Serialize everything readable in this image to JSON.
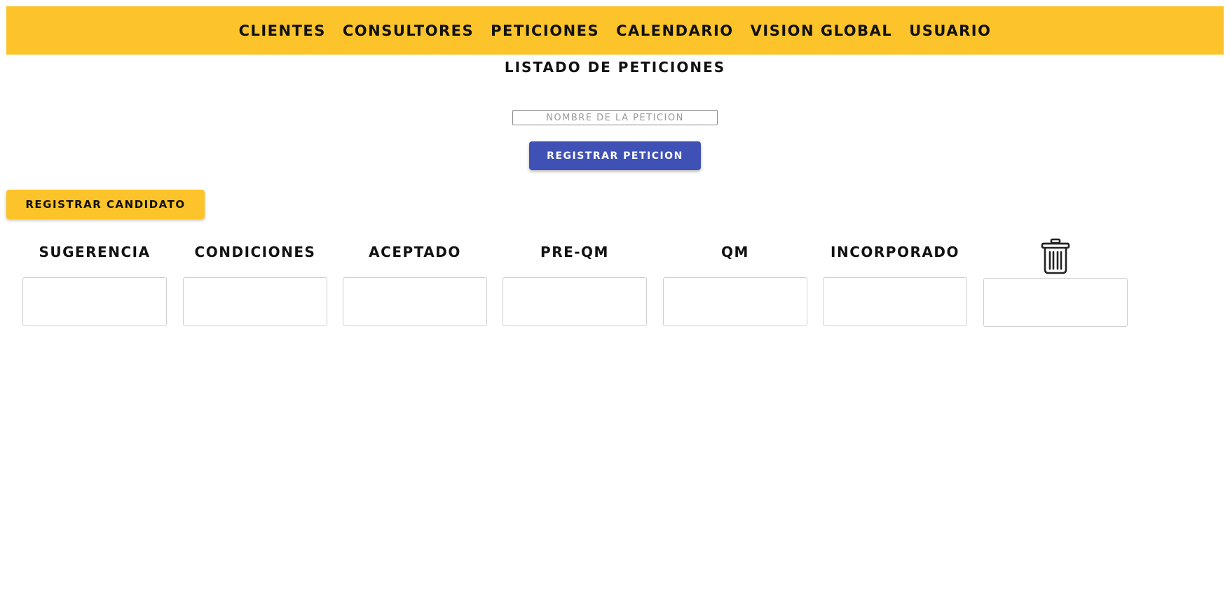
{
  "nav": {
    "items": [
      {
        "label": "CLIENTES"
      },
      {
        "label": "CONSULTORES"
      },
      {
        "label": "PETICIONES"
      },
      {
        "label": "CALENDARIO"
      },
      {
        "label": "VISION GLOBAL"
      },
      {
        "label": "USUARIO"
      }
    ]
  },
  "page": {
    "title": "LISTADO DE PETICIONES"
  },
  "form": {
    "name_placeholder": "NOMBRE DE LA PETICION",
    "name_value": "",
    "register_label": "REGISTRAR PETICION"
  },
  "actions": {
    "register_candidate_label": "REGISTRAR CANDIDATO"
  },
  "board": {
    "columns": [
      {
        "label": "SUGERENCIA"
      },
      {
        "label": "CONDICIONES"
      },
      {
        "label": "ACEPTADO"
      },
      {
        "label": "PRE-QM"
      },
      {
        "label": "QM"
      },
      {
        "label": "INCORPORADO"
      }
    ],
    "trash_icon": "trash-icon"
  },
  "colors": {
    "topbar": "#fcc42a",
    "primary_button": "#3f51b5",
    "accent_button": "#fcc42a"
  }
}
